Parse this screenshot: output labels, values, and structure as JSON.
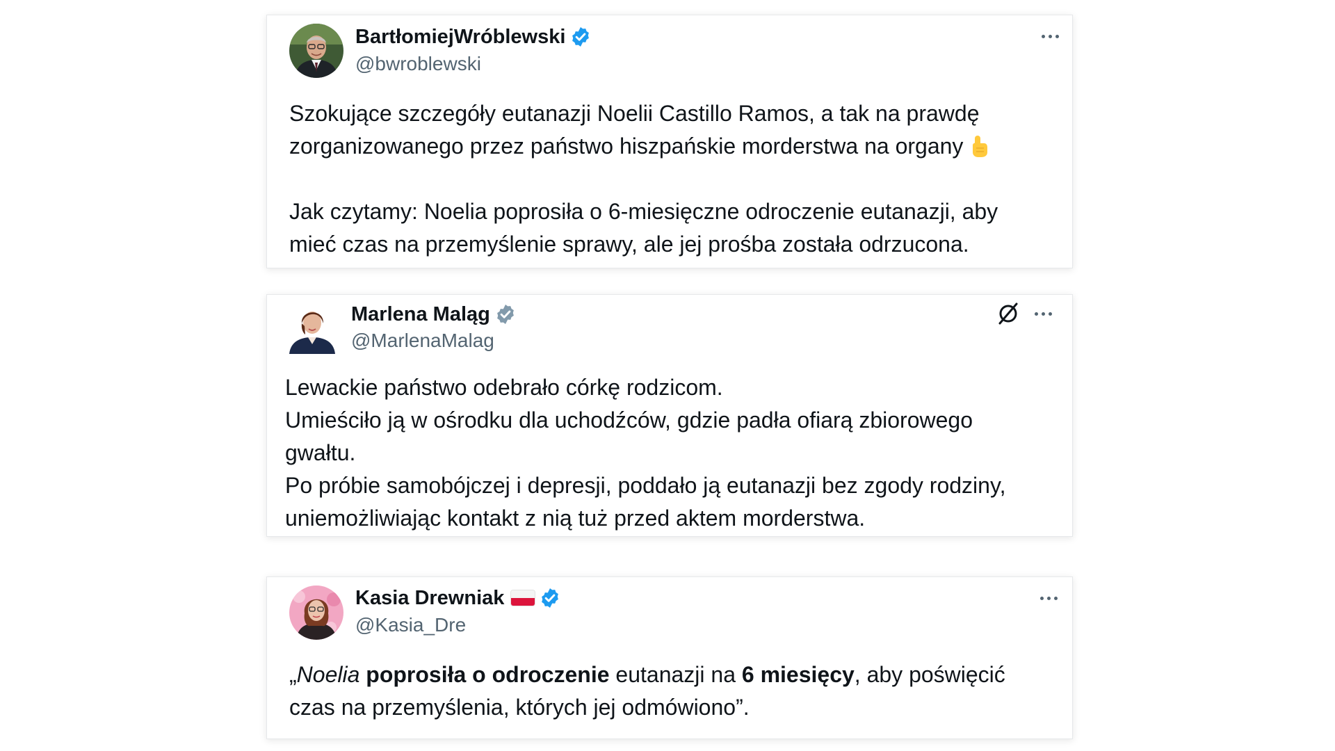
{
  "posts": [
    {
      "name": "BartłomiejWróblewski",
      "handle": "@bwroblewski",
      "verified": true,
      "badge_color": "#1d9bf0",
      "paragraphs": [
        {
          "lines": [
            "Szokujące szczegóły eutanazji Noelii Castillo Ramos, a tak na prawdę",
            "zorganizowanego przez państwo hiszpańskie morderstwa na organy"
          ],
          "emoji": "pointing-up-finger-emoji"
        },
        {
          "lines": [
            "Jak czytamy: Noelia poprosiła o 6-miesięczne odroczenie eutanazji, aby",
            "mieć czas na przemyślenie sprawy, ale jej prośba została odrzucona."
          ]
        }
      ]
    },
    {
      "name": "Marlena Maląg",
      "handle": "@MarlenaMalag",
      "verified": true,
      "badge_color": "#829aab",
      "lines": [
        "Lewackie państwo odebrało córkę rodzicom.",
        "Umieściło ją w ośrodku dla uchodźców, gdzie padła ofiarą zbiorowego",
        "gwałtu.",
        "Po próbie samobójczej i depresji, poddało ją eutanazji bez zgody rodziny,",
        "uniemożliwiając kontakt z nią tuż przed aktem morderstwa."
      ]
    },
    {
      "name": "Kasia Drewniak",
      "handle": "@Kasia_Dre",
      "verified": true,
      "badge_color": "#1d9bf0",
      "flag": "poland-flag-icon",
      "quote": {
        "open_quote": "„",
        "name": "Noelia",
        "bold1": "poprosiła o odroczenie",
        "text1": "eutanazji na",
        "bold2": "6 miesięcy",
        "text2": ", aby poświęcić",
        "line2": "czas na przemyślenia, których jej odmówiono”."
      }
    }
  ],
  "icons": {
    "more": "more-options-icon",
    "verified": "verified-badge-icon",
    "grok": "grok-icon"
  }
}
